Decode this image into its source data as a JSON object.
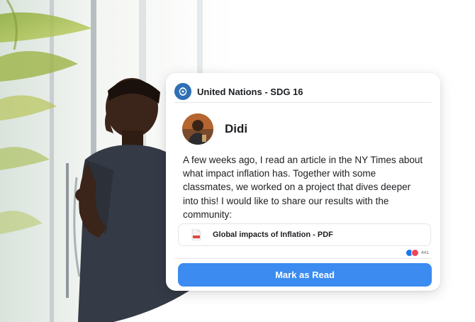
{
  "post": {
    "org_name": "United Nations - SDG 16",
    "author_name": "Didi",
    "message": "A few weeks ago, I read an article in the NY Times about what impact inflation has. Together with some classmates, we worked on a project that dives deeper into this! I would like to share our results with the community:",
    "attachment": {
      "label": "Global impacts of Inflation - PDF",
      "icon": "pdf-file-icon"
    },
    "reactions": {
      "icons": [
        "like-icon",
        "love-icon"
      ],
      "count": "441"
    }
  },
  "actions": {
    "mark_read_label": "Mark as Read"
  },
  "colors": {
    "primary_button": "#3b8bf0",
    "org_logo": "#2f6fb3",
    "text": "#1c1e21"
  }
}
